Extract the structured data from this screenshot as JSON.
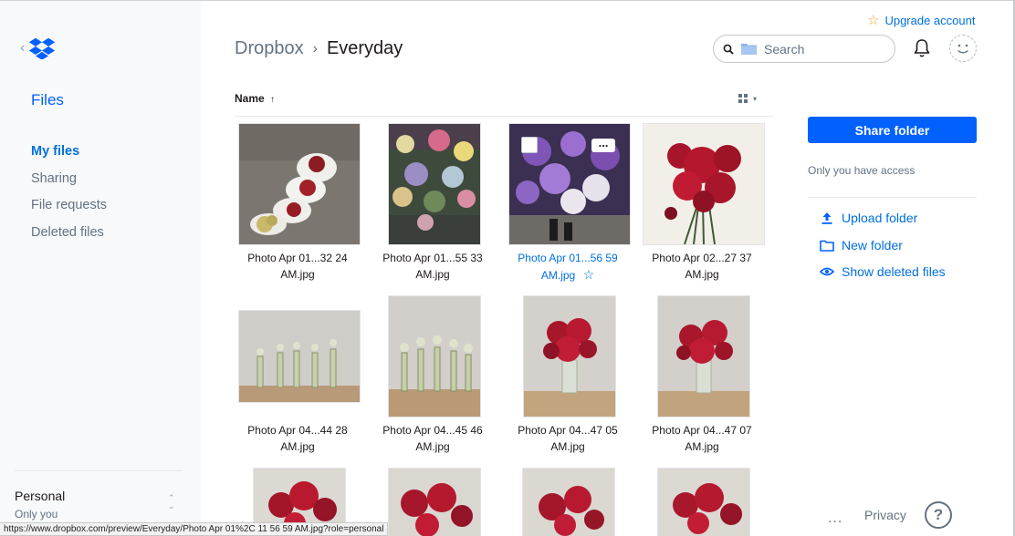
{
  "sidebar": {
    "title": "Files",
    "nav": [
      {
        "label": "My files",
        "active": true
      },
      {
        "label": "Sharing",
        "active": false
      },
      {
        "label": "File requests",
        "active": false
      },
      {
        "label": "Deleted files",
        "active": false
      }
    ],
    "account": {
      "name": "Personal",
      "subtitle": "Only you"
    }
  },
  "header": {
    "upgrade_label": "Upgrade account",
    "breadcrumb": {
      "root": "Dropbox",
      "current": "Everyday"
    },
    "search_placeholder": "Search"
  },
  "list": {
    "sort_column": "Name",
    "sort_arrow": "↑"
  },
  "files": [
    {
      "line1": "Photo Apr 01...32 24",
      "line2": "AM.jpg",
      "thumb": "bouquet-wrapped",
      "highlighted": false
    },
    {
      "line1": "Photo Apr 01...55 33",
      "line2": "AM.jpg",
      "thumb": "flower-market",
      "highlighted": false
    },
    {
      "line1": "Photo Apr 01...56 59",
      "line2": "AM.jpg",
      "thumb": "purple-flowers",
      "highlighted": true
    },
    {
      "line1": "Photo Apr 02...27 37",
      "line2": "AM.jpg",
      "thumb": "red-dahlias",
      "highlighted": false
    },
    {
      "line1": "Photo Apr 04...44 28",
      "line2": "AM.jpg",
      "thumb": "bud-vases",
      "highlighted": false
    },
    {
      "line1": "Photo Apr 04...45 46",
      "line2": "AM.jpg",
      "thumb": "bud-vases",
      "highlighted": false
    },
    {
      "line1": "Photo Apr 04...47 05",
      "line2": "AM.jpg",
      "thumb": "red-vase",
      "highlighted": false
    },
    {
      "line1": "Photo Apr 04...47 07",
      "line2": "AM.jpg",
      "thumb": "red-vase",
      "highlighted": false
    }
  ],
  "panel": {
    "share_label": "Share folder",
    "access_text": "Only you have access",
    "actions": [
      {
        "label": "Upload folder",
        "icon": "upload-icon"
      },
      {
        "label": "New folder",
        "icon": "folder-icon"
      },
      {
        "label": "Show deleted files",
        "icon": "eye-icon"
      }
    ]
  },
  "footer": {
    "more": "...",
    "privacy": "Privacy",
    "help": "?"
  },
  "status_url": "https://www.dropbox.com/preview/Everyday/Photo Apr 01%2C 11 56 59 AM.jpg?role=personal",
  "colors": {
    "accent": "#0061fe",
    "link": "#0070e0",
    "sidebar_bg": "#f7f9fa",
    "muted": "#637282",
    "star": "#f5a623"
  }
}
